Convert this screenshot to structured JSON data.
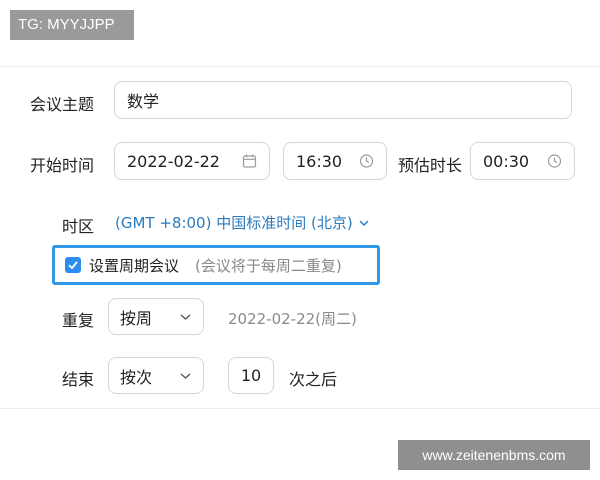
{
  "watermarks": {
    "top": "TG: MYYJJPP",
    "bottom": "www.zeitenenbms.com"
  },
  "topic": {
    "label": "会议主题",
    "value": "数学"
  },
  "start": {
    "label": "开始时间",
    "date": "2022-02-22",
    "time": "16:30"
  },
  "duration": {
    "label": "预估时长",
    "value": "00:30"
  },
  "timezone": {
    "label": "时区",
    "value": "(GMT +8:00) 中国标准时间 (北京)"
  },
  "recurring": {
    "checked": true,
    "label": "设置周期会议",
    "hint": "(会议将于每周二重复)"
  },
  "repeat": {
    "label": "重复",
    "selected": "按周",
    "info": "2022-02-22(周二)"
  },
  "end": {
    "label": "结束",
    "selected": "按次",
    "count": "10",
    "suffix": "次之后"
  },
  "colors": {
    "accent": "#2d8cf0",
    "highlight_border": "#2f97e5",
    "timezone_text": "#2a7bc0"
  }
}
